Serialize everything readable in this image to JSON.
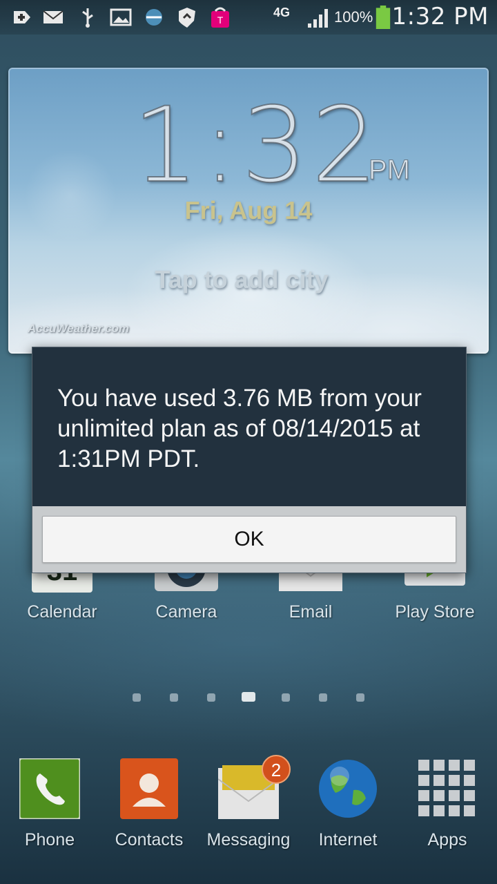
{
  "status_bar": {
    "network": "4G",
    "battery_percent": "100%",
    "time": "1:32 PM",
    "icons": [
      "add-icon",
      "email-icon",
      "usb-icon",
      "gallery-icon",
      "sync-icon",
      "shield-icon",
      "tmobile-icon",
      "signal-icon",
      "battery-icon"
    ],
    "accent_battery": "#7ac943"
  },
  "weather_widget": {
    "time": "1:32",
    "ampm": "PM",
    "date": "Fri, Aug 14",
    "add_city": "Tap to add city",
    "brand": "AccuWeather.com"
  },
  "dialog": {
    "message": "You have used 3.76 MB from your unlimited plan as of 08/14/2015 at 1:31PM PDT.",
    "ok_label": "OK"
  },
  "home_apps": [
    {
      "label": "Calendar",
      "icon": "calendar-icon"
    },
    {
      "label": "Camera",
      "icon": "camera-icon"
    },
    {
      "label": "Email",
      "icon": "email-app-icon"
    },
    {
      "label": "Play Store",
      "icon": "play-store-icon"
    }
  ],
  "page_indicator": {
    "active_index": 3,
    "count": 7
  },
  "dock": [
    {
      "label": "Phone",
      "icon": "phone-icon"
    },
    {
      "label": "Contacts",
      "icon": "contacts-icon"
    },
    {
      "label": "Messaging",
      "icon": "messaging-icon",
      "badge": "2"
    },
    {
      "label": "Internet",
      "icon": "globe-icon"
    },
    {
      "label": "Apps",
      "icon": "apps-grid-icon"
    }
  ]
}
